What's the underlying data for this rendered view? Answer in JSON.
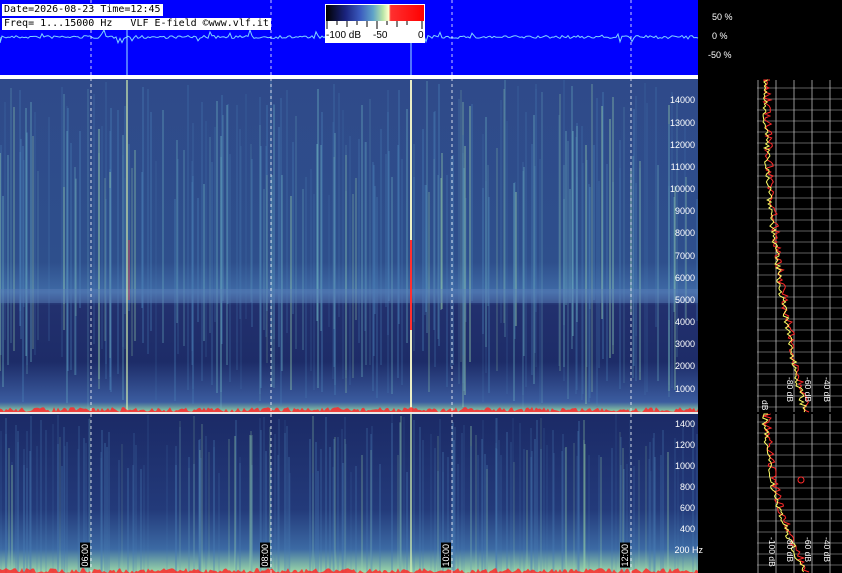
{
  "header": {
    "line1": "Date=2026-08-23 Time=12:45",
    "line2": "Freq= 1...15000 Hz   VLF E-field ©www.vlf.it"
  },
  "colorbar": {
    "labels": [
      "-100 dB",
      "-50",
      "0"
    ],
    "stops": [
      "#000000",
      "#1a237e",
      "#3b5bbf",
      "#5fa3c8",
      "#b7e4a7",
      "#ffffcc",
      "#ff0000"
    ]
  },
  "waveform": {
    "scale_labels": [
      "50 %",
      "0 %",
      "-50 %"
    ],
    "background": "#0000ff",
    "trace_color": "#66ccff"
  },
  "spectrogram_top": {
    "freq_ticks": [
      "14000",
      "13000",
      "12000",
      "11000",
      "10000",
      "9000",
      "8000",
      "7000",
      "6000",
      "5000",
      "4000",
      "3000",
      "2000",
      "1000"
    ],
    "background": "#1f2f6e"
  },
  "spectrogram_bottom": {
    "freq_ticks": [
      "1400",
      "1200",
      "1000",
      "800",
      "600",
      "400",
      "200 Hz"
    ]
  },
  "time_labels": [
    "06:00",
    "08:00",
    "10:00",
    "12:00"
  ],
  "profile_top": {
    "db_labels": [
      "dB",
      "-80 dB",
      "-60 dB",
      "-40 dB",
      "-20 dB"
    ]
  },
  "profile_bottom": {
    "db_labels": [
      "-100 dB",
      "-80 dB",
      "-60 dB",
      "-40 dB",
      "-20 dB"
    ]
  }
}
